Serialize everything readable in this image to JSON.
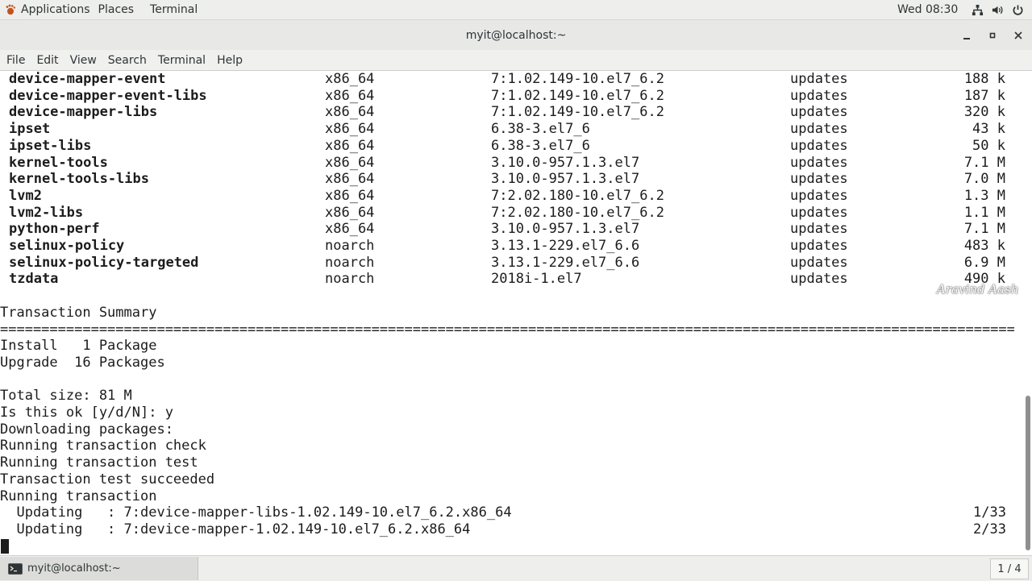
{
  "top_panel": {
    "applications": "Applications",
    "places": "Places",
    "terminal": "Terminal",
    "clock": "Wed 08:30",
    "tray_icons": [
      "network-icon",
      "volume-icon",
      "power-icon"
    ]
  },
  "window": {
    "title": "myit@localhost:~"
  },
  "menubar": {
    "items": [
      "File",
      "Edit",
      "View",
      "Search",
      "Terminal",
      "Help"
    ]
  },
  "terminal": {
    "packages": [
      {
        "name": "device-mapper-event",
        "arch": "x86_64",
        "version": "7:1.02.149-10.el7_6.2",
        "repo": "updates",
        "size": "188 k"
      },
      {
        "name": "device-mapper-event-libs",
        "arch": "x86_64",
        "version": "7:1.02.149-10.el7_6.2",
        "repo": "updates",
        "size": "187 k"
      },
      {
        "name": "device-mapper-libs",
        "arch": "x86_64",
        "version": "7:1.02.149-10.el7_6.2",
        "repo": "updates",
        "size": "320 k"
      },
      {
        "name": "ipset",
        "arch": "x86_64",
        "version": "6.38-3.el7_6",
        "repo": "updates",
        "size": "43 k"
      },
      {
        "name": "ipset-libs",
        "arch": "x86_64",
        "version": "6.38-3.el7_6",
        "repo": "updates",
        "size": "50 k"
      },
      {
        "name": "kernel-tools",
        "arch": "x86_64",
        "version": "3.10.0-957.1.3.el7",
        "repo": "updates",
        "size": "7.1 M"
      },
      {
        "name": "kernel-tools-libs",
        "arch": "x86_64",
        "version": "3.10.0-957.1.3.el7",
        "repo": "updates",
        "size": "7.0 M"
      },
      {
        "name": "lvm2",
        "arch": "x86_64",
        "version": "7:2.02.180-10.el7_6.2",
        "repo": "updates",
        "size": "1.3 M"
      },
      {
        "name": "lvm2-libs",
        "arch": "x86_64",
        "version": "7:2.02.180-10.el7_6.2",
        "repo": "updates",
        "size": "1.1 M"
      },
      {
        "name": "python-perf",
        "arch": "x86_64",
        "version": "3.10.0-957.1.3.el7",
        "repo": "updates",
        "size": "7.1 M"
      },
      {
        "name": "selinux-policy",
        "arch": "noarch",
        "version": "3.13.1-229.el7_6.6",
        "repo": "updates",
        "size": "483 k"
      },
      {
        "name": "selinux-policy-targeted",
        "arch": "noarch",
        "version": "3.13.1-229.el7_6.6",
        "repo": "updates",
        "size": "6.9 M"
      },
      {
        "name": "tzdata",
        "arch": "noarch",
        "version": "2018i-1.el7",
        "repo": "updates",
        "size": "490 k"
      }
    ],
    "summary_title": "Transaction Summary",
    "separator": "================================================================================================================================",
    "install_line": "Install   1 Package",
    "upgrade_line": "Upgrade  16 Packages",
    "total_size": "Total size: 81 M",
    "prompt": "Is this ok [y/d/N]: y",
    "downloading": "Downloading packages:",
    "check": "Running transaction check",
    "test": "Running transaction test",
    "succeeded": "Transaction test succeeded",
    "running": "Running transaction",
    "progress": [
      {
        "text": "  Updating   : 7:device-mapper-libs-1.02.149-10.el7_6.2.x86_64",
        "count": "1/33"
      },
      {
        "text": "  Updating   : 7:device-mapper-1.02.149-10.el7_6.2.x86_64",
        "count": "2/33"
      }
    ],
    "watermark": "Aravind Aash"
  },
  "taskbar": {
    "task_label": "myit@localhost:~",
    "workspace": "1 / 4"
  }
}
